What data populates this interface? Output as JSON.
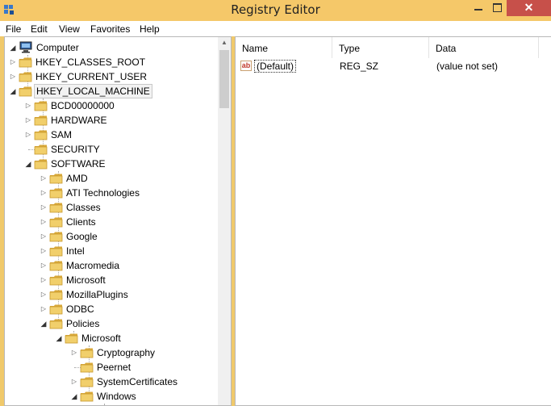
{
  "window": {
    "title": "Registry Editor"
  },
  "menu": [
    "File",
    "Edit",
    "View",
    "Favorites",
    "Help"
  ],
  "tree": {
    "root": "Computer",
    "hives": [
      "HKEY_CLASSES_ROOT",
      "HKEY_CURRENT_USER",
      "HKEY_LOCAL_MACHINE"
    ],
    "hklm_children": [
      "BCD00000000",
      "HARDWARE",
      "SAM",
      "SECURITY",
      "SOFTWARE"
    ],
    "software_children": [
      "AMD",
      "ATI Technologies",
      "Classes",
      "Clients",
      "Google",
      "Intel",
      "Macromedia",
      "Microsoft",
      "MozillaPlugins",
      "ODBC",
      "Policies"
    ],
    "policies_children": [
      "Microsoft"
    ],
    "policies_microsoft_children": [
      "Cryptography",
      "Peernet",
      "SystemCertificates",
      "Windows"
    ]
  },
  "values": {
    "columns": [
      "Name",
      "Type",
      "Data"
    ],
    "rows": [
      {
        "name": "(Default)",
        "type": "REG_SZ",
        "data": "(value not set)"
      }
    ]
  },
  "colors": {
    "titlebar": "#f5c869",
    "close_button": "#c7504a",
    "folder": "#e9c25a"
  }
}
